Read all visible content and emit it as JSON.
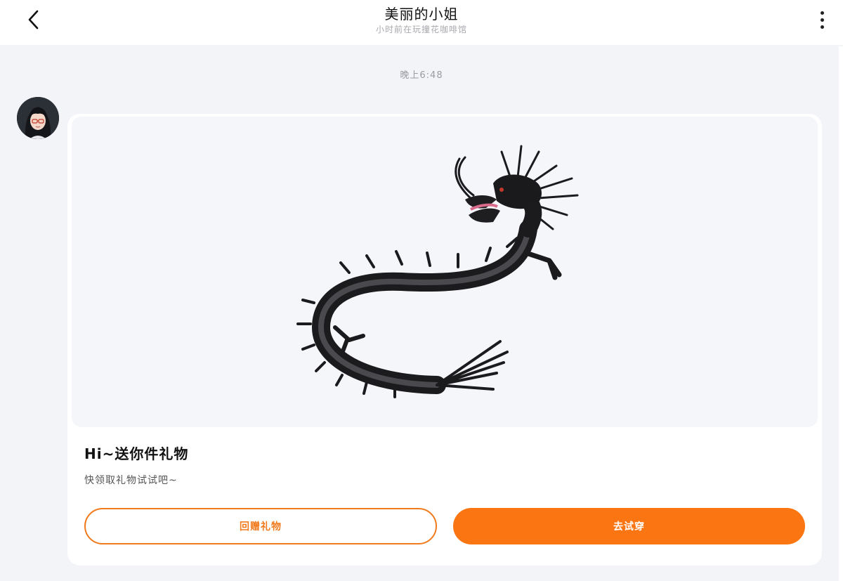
{
  "header": {
    "title": "美丽的小姐",
    "subtitle": "小时前在玩撞花咖啡馆",
    "back_icon": "chevron-left-icon",
    "more_icon": "more-vertical-icon"
  },
  "chat": {
    "timestamp": "晚上6:48"
  },
  "gift_card": {
    "title": "Hi~送你件礼物",
    "description": "快领取礼物试试吧~",
    "secondary_button": "回赠礼物",
    "primary_button": "去试穿",
    "accent_color": "#fb7613",
    "image_subject": "black-dragon"
  }
}
